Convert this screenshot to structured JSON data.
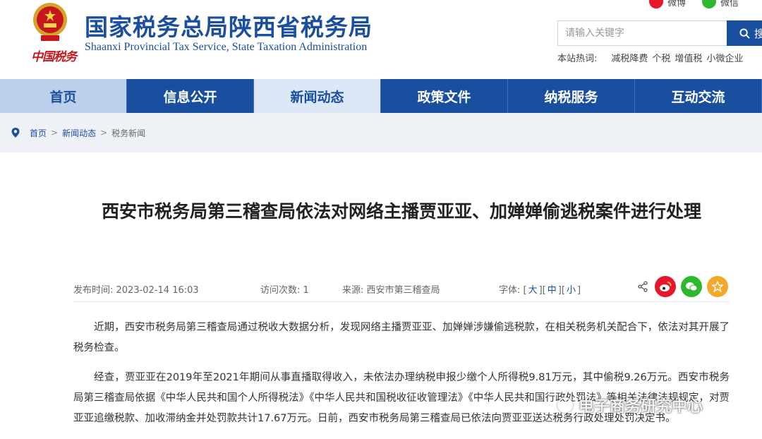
{
  "header": {
    "china_tax_logo_text": "中国税务",
    "title": "国家税务总局陕西省税务局",
    "subtitle": "Shaanxi Provincial Tax Service, State Taxation Administration",
    "social": {
      "weibo": "微博",
      "wechat": "微信"
    },
    "search": {
      "placeholder": "请输入关键字",
      "button": "搜"
    },
    "hot": {
      "label": "本站热词:",
      "words": [
        "减税降费",
        "个税",
        "增值税",
        "小微企业"
      ]
    }
  },
  "nav": {
    "items": [
      "首页",
      "信息公开",
      "新闻动态",
      "政策文件",
      "纳税服务",
      "互动交流"
    ]
  },
  "breadcrumb": {
    "home": "首页",
    "sep": ">",
    "section": "新闻动态",
    "current": "税务新闻"
  },
  "article": {
    "title": "西安市税务局第三稽查局依法对网络主播贾亚亚、加婵婵偷逃税案件进行处理",
    "meta": {
      "publish_time": "发布时间: 2023-02-14 16:03",
      "visits": "访问次数: 1",
      "source": "来源: 西安市第三稽查局",
      "font_label": "字体: [",
      "font_large": "大",
      "font_medium": "中",
      "font_small": "小",
      "bracket_sep": "][",
      "bracket_end": "]"
    },
    "paragraphs": [
      "近期，西安市税务局第三稽查局通过税收大数据分析，发现网络主播贾亚亚、加婵婵涉嫌偷逃税款，在相关税务机关配合下，依法对其开展了税务检查。",
      "经查，贾亚亚在2019年至2021年期间从事直播取得收入，未依法办理纳税申报少缴个人所得税9.81万元，其中偷税9.26万元。西安市税务局第三稽查局依据《中华人民共和国个人所得税法》《中华人民共和国税收征收管理法》《中华人民共和国行政处罚法》等相关法律法规规定，对贾亚亚追缴税款、加收滞纳金并处罚款共计17.67万元。日前，西安市税务局第三稽查局已依法向贾亚亚送达税务行政处理处罚决定书。"
    ]
  },
  "watermark": "电子商务研究中心",
  "colors": {
    "brand_blue": "#1a4fa0",
    "nav_active": "#bcd0ec",
    "red": "#c8161d"
  }
}
